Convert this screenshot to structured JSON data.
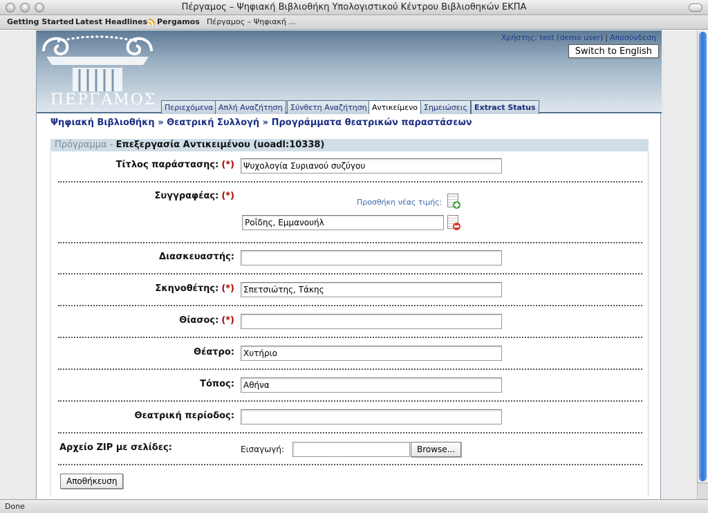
{
  "window": {
    "title": "Πέργαμος – Ψηφιακή Βιβλιοθήκη Υπολογιστικού Κέντρου Βιβλιοθηκών ΕΚΠΑ"
  },
  "bookmarks": {
    "getting_started": "Getting Started",
    "latest_headlines": "Latest Headlines",
    "pergamos": "Pergamos",
    "pergamos_page": "Πέργαμος – Ψηφιακή ..."
  },
  "header": {
    "logo_text": "ΠΕΡΓΑΜΟΣ",
    "user_label": "Χρήστης: test (demo user)",
    "separator": "|",
    "logout": "Αποσύνδεση",
    "switch_language": "Switch to English"
  },
  "tabs": [
    {
      "label": "Περιεχόμενα"
    },
    {
      "label": "Απλή Αναζήτηση"
    },
    {
      "label": "Σύνθετη Αναζήτηση"
    },
    {
      "label": "Αντικείμενο"
    },
    {
      "label": "Σημειώσεις"
    },
    {
      "label": "Extract Status"
    }
  ],
  "breadcrumb": "Ψηφιακή Βιβλιοθήκη » Θεατρική Συλλογή » Προγράμματα θεατρικών παραστάσεων",
  "section": {
    "prefix": "Πρόγραμμα -",
    "title": "Επεξεργασία Αντικειμένου (uoadl:10338)"
  },
  "form": {
    "required_mark": "(*)",
    "title_label": "Τίτλος παράστασης:",
    "title_value": "Ψυχολογία Συριανού συζύγου",
    "author_label": "Συγγραφέας:",
    "add_value_label": "Προσθήκη νέας τιμής:",
    "author_value": "Ροΐδης, Εμμανουήλ",
    "adapter_label": "Διασκευαστής:",
    "adapter_value": "",
    "director_label": "Σκηνοθέτης:",
    "director_value": "Σπετσιώτης, Τάκης",
    "troupe_label": "Θίασος:",
    "troupe_value": "",
    "theatre_label": "Θέατρο:",
    "theatre_value": "Χυτήριο",
    "place_label": "Τόπος:",
    "place_value": "Αθήνα",
    "season_label": "Θεατρική περίοδος:",
    "season_value": "",
    "zip_label": "Αρχείο ZIP με σελίδες:",
    "import_label": "Εισαγωγή:",
    "browse_button": "Browse...",
    "save_button": "Αποθήκευση"
  },
  "status": "Done"
}
